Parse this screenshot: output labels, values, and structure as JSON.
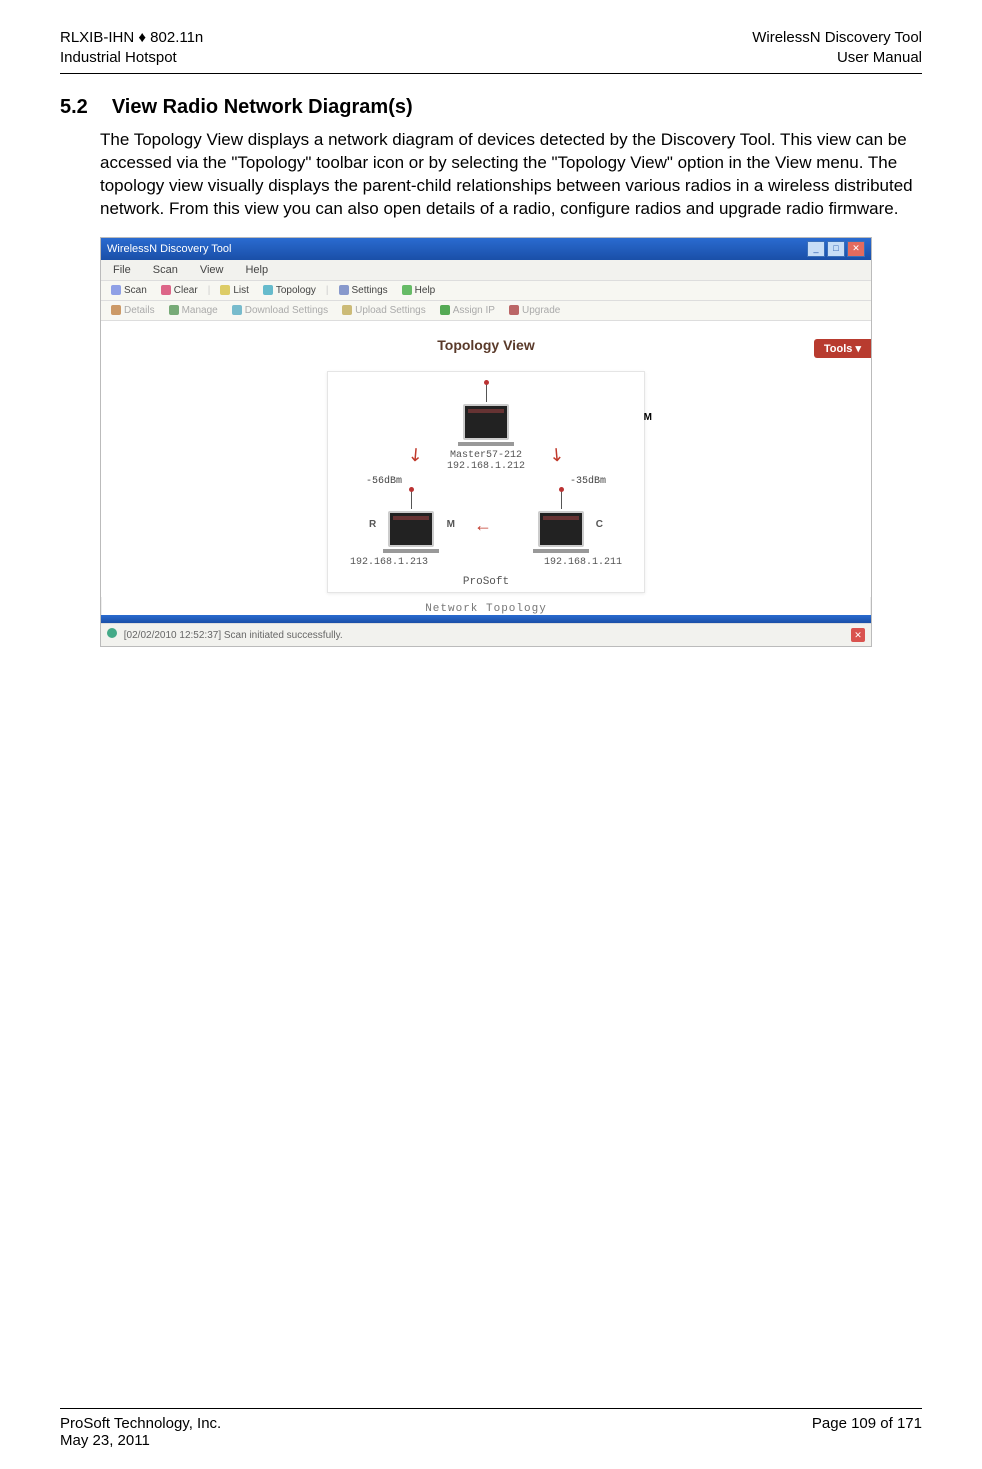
{
  "header": {
    "left_line1": "RLXIB-IHN ♦ 802.11n",
    "left_line2": "Industrial Hotspot",
    "right_line1": "WirelessN Discovery Tool",
    "right_line2": "User Manual"
  },
  "section": {
    "number": "5.2",
    "title": "View Radio Network Diagram(s)",
    "paragraph": "The Topology View displays a network diagram of devices detected by the Discovery Tool. This view can be accessed via the \"Topology\" toolbar icon or by selecting the \"Topology View\" option in the View menu. The topology view visually displays the parent-child relationships between various radios in a wireless distributed network. From this view you can also open details of a radio, configure radios and upgrade radio firmware."
  },
  "screenshot": {
    "window_title": "WirelessN Discovery Tool",
    "menu": {
      "items": [
        "File",
        "Scan",
        "View",
        "Help"
      ]
    },
    "toolbar1": {
      "scan": "Scan",
      "clear": "Clear",
      "list": "List",
      "topology": "Topology",
      "settings": "Settings",
      "help": "Help"
    },
    "toolbar2": {
      "details": "Details",
      "manage": "Manage",
      "download_settings": "Download Settings",
      "upload_settings": "Upload Settings",
      "assign_ip": "Assign IP",
      "upgrade": "Upgrade"
    },
    "view_title": "Topology View",
    "tools_btn": "Tools",
    "diagram": {
      "master": {
        "role": "M",
        "name": "Master57-212",
        "ip": "192.168.1.212"
      },
      "links": {
        "left_signal": "-56dBm",
        "right_signal": "-35dBm"
      },
      "left_node": {
        "roles": "R  M",
        "ip": "192.168.1.213"
      },
      "right_node": {
        "role": "C",
        "ip": "192.168.1.211"
      },
      "vendor": "ProSoft",
      "caption": "Network Topology"
    },
    "statusbar": {
      "text": "[02/02/2010 12:52:37] Scan initiated successfully."
    }
  },
  "footer": {
    "left_line1": "ProSoft Technology, Inc.",
    "left_line2": "May 23, 2011",
    "right": "Page 109 of 171"
  }
}
